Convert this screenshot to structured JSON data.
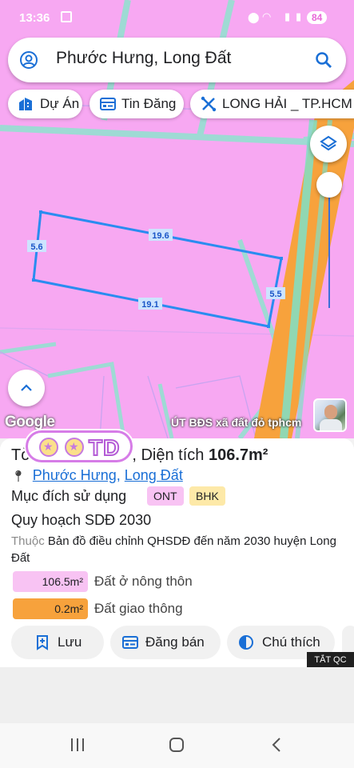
{
  "status_bar": {
    "time": "13:36",
    "battery": "84"
  },
  "search": {
    "query": "Phước Hưng, Long Đất"
  },
  "chips": [
    {
      "label": "Dự Án",
      "icon": "building-icon"
    },
    {
      "label": "Tin Đăng",
      "icon": "listing-icon"
    },
    {
      "label": "LONG HẢI _ TP.HCM",
      "icon": "route-icon"
    }
  ],
  "map": {
    "parcel_dimensions": {
      "top": "19.6",
      "bottom": "19.1",
      "left": "5.6",
      "right": "5.5"
    },
    "google_label": "Google",
    "owner_label": "ÚT BĐS xã đất đỏ tphcm",
    "colors": {
      "rural_land": "#f7a8f2",
      "road": "#f7a23c",
      "boundary": "#2a8cf0"
    }
  },
  "panel": {
    "title_prefix": "Tờ",
    "title_middle": ", Diện tích ",
    "area": "106.7m²",
    "address_parts": [
      "Phước Hưng",
      "Long Đất"
    ],
    "purpose_label": "Mục đích sử dụng",
    "tags": [
      "ONT",
      "BHK"
    ],
    "planning": "Quy hoạch SDĐ 2030",
    "belongs_label": "Thuộc",
    "belongs_value": "Bản đồ điều chỉnh QHSDĐ đến năm 2030 huyện Long Đất",
    "legend": [
      {
        "value": "106.5m²",
        "label": "Đất ở nông thôn",
        "color": "#f8c3f3"
      },
      {
        "value": "0.2m²",
        "label": "Đất giao thông",
        "color": "#f7a23c"
      }
    ],
    "actions": {
      "save": "Lưu",
      "sell": "Đăng bán",
      "legend": "Chú thích"
    },
    "ads_off": "TẮT QC",
    "logo_text": "TD"
  }
}
